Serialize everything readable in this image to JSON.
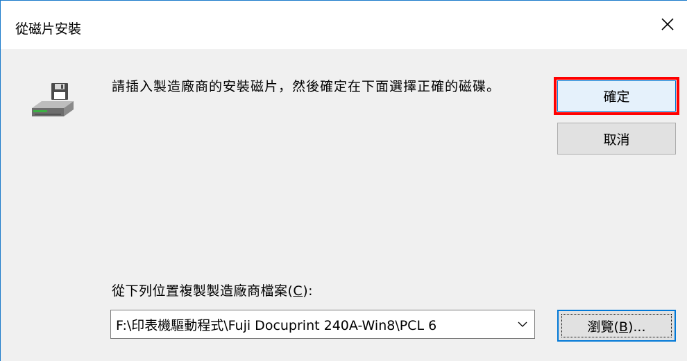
{
  "window": {
    "title": "從磁片安裝",
    "close_icon": "close-icon"
  },
  "content": {
    "icon": "floppy-disk-drive-icon",
    "message": "請插入製造廠商的安裝磁片，然後確定在下面選擇正確的磁碟。"
  },
  "buttons": {
    "ok_label": "確定",
    "cancel_label": "取消",
    "browse_label_pre": "瀏覽(",
    "browse_label_mnemonic": "B",
    "browse_label_post": ")..."
  },
  "copy": {
    "label_pre": "從下列位置複製製造廠商檔案(",
    "label_mnemonic": "C",
    "label_post": "):",
    "path_value": "F:\\印表機驅動程式\\Fuji Docuprint 240A-Win8\\PCL 6"
  },
  "colors": {
    "accent": "#0078d7",
    "highlight": "#ff0000"
  }
}
